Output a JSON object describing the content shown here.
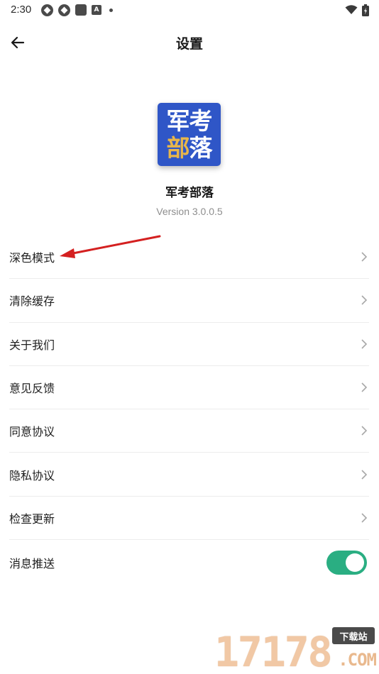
{
  "status_bar": {
    "time": "2:30",
    "icons": [
      "sync-icon",
      "sync-icon",
      "square-icon",
      "a-icon",
      "dot-icon",
      "wifi-icon",
      "battery-icon"
    ]
  },
  "app_bar": {
    "title": "设置",
    "back_icon": "arrow-left-icon"
  },
  "app_info": {
    "logo_line_1": "军考",
    "logo_line_2a": "部",
    "logo_line_2b": "落",
    "name": "军考部落",
    "version": "Version 3.0.0.5"
  },
  "settings": {
    "items": [
      {
        "label": "深色模式",
        "control": "chevron"
      },
      {
        "label": "清除缓存",
        "control": "chevron"
      },
      {
        "label": "关于我们",
        "control": "chevron"
      },
      {
        "label": "意见反馈",
        "control": "chevron"
      },
      {
        "label": "同意协议",
        "control": "chevron"
      },
      {
        "label": "隐私协议",
        "control": "chevron"
      },
      {
        "label": "检查更新",
        "control": "chevron"
      },
      {
        "label": "消息推送",
        "control": "toggle",
        "on": true
      }
    ]
  },
  "colors": {
    "logo_bg": "#2f56c7",
    "logo_gold": "#e8b64a",
    "toggle_on": "#2aae82",
    "arrow": "#d42020"
  },
  "watermark": {
    "digits": "17178",
    "badge": "下载站",
    "domain": ".COM"
  }
}
